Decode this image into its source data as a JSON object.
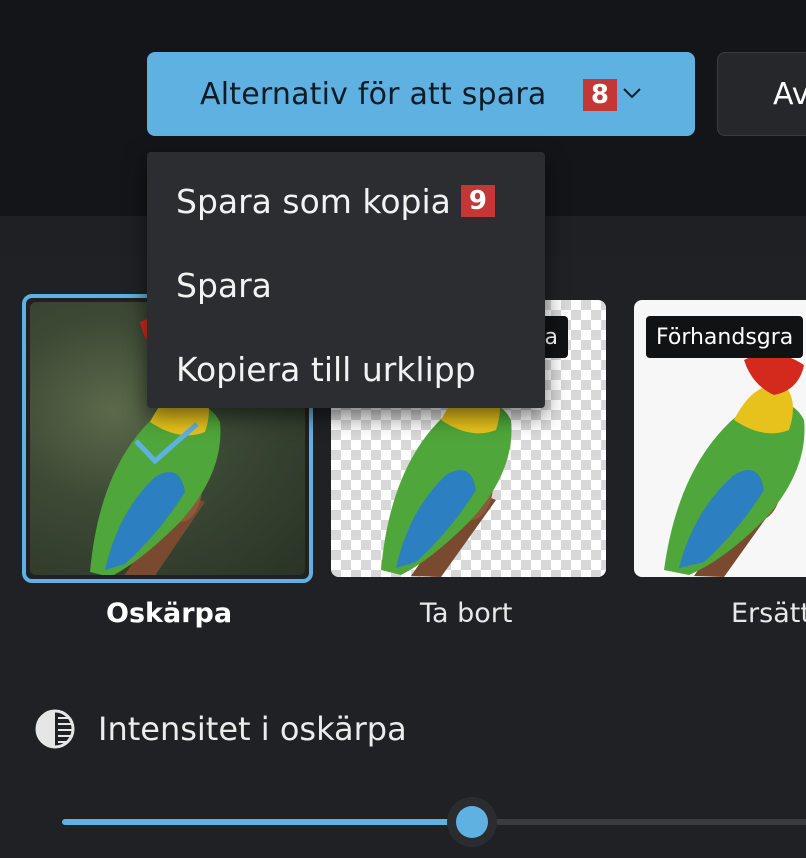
{
  "toolbar": {
    "save_options_label": "Alternativ för att spara",
    "save_options_badge": "8",
    "second_button_label": "Av"
  },
  "save_menu": {
    "items": [
      {
        "label": "Spara som kopia",
        "badge": "9"
      },
      {
        "label": "Spara"
      },
      {
        "label": "Kopiera till urklipp"
      }
    ]
  },
  "background_options": {
    "selected": "Oskärpa",
    "tiles": [
      {
        "label": "Oskärpa",
        "tag": ""
      },
      {
        "label": "Ta bort",
        "tag": "a"
      },
      {
        "label": "Ersätt",
        "tag": "Förhandsgra"
      }
    ]
  },
  "intensity": {
    "label": "Intensitet i oskärpa",
    "value_fraction": 0.54
  },
  "colors": {
    "accent": "#5fb1e2",
    "badge": "#c33737",
    "background": "#1c1d20"
  },
  "icons": [
    "chevron-down-icon",
    "checkmark-icon",
    "contrast-icon"
  ]
}
